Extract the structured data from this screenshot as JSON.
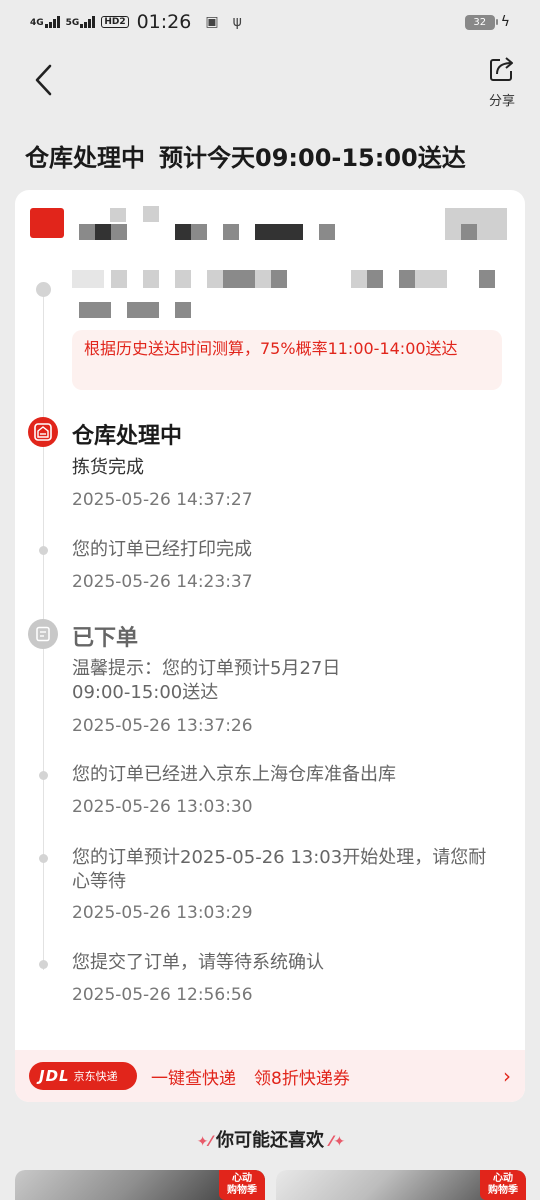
{
  "status_bar": {
    "sim1": "4G",
    "sim2": "5G",
    "hd": "HD2",
    "time": "01:26",
    "battery": "32"
  },
  "nav": {
    "share_label": "分享"
  },
  "header": {
    "status": "仓库处理中",
    "eta": "预计今天09:00-15:00送达"
  },
  "prediction_hint": "根据历史送达时间测算，75%概率11:00-14:00送达",
  "timeline": [
    {
      "heading": "仓库处理中",
      "text": "拣货完成",
      "time": "2025-05-26  14:37:27"
    },
    {
      "text": "您的订单已经打印完成",
      "time": "2025-05-26  14:23:37"
    },
    {
      "heading": "已下单",
      "text": "温馨提示：您的订单预计5月27日\n09:00-15:00送达",
      "time": "2025-05-26  13:37:26"
    },
    {
      "text": "您的订单已经进入京东上海仓库准备出库",
      "time": "2025-05-26  13:03:30"
    },
    {
      "text": "您的订单预计2025-05-26  13:03开始处理，请您耐心等待",
      "time": "2025-05-26  13:03:29"
    },
    {
      "text": "您提交了订单，请等待系统确认",
      "time": "2025-05-26  12:56:56"
    }
  ],
  "express_bar": {
    "logo_main": "JDL",
    "logo_sub": "京东快递",
    "query_link": "一键查快递",
    "coupon_link": "领8折快递券",
    "arrow": "›"
  },
  "recommend": {
    "title": "你可能还喜欢",
    "badge": "心动\n购物季"
  },
  "colors": {
    "accent": "#e1251b",
    "hint_bg": "#fdf1ef",
    "express_bg": "#fdeeee"
  }
}
